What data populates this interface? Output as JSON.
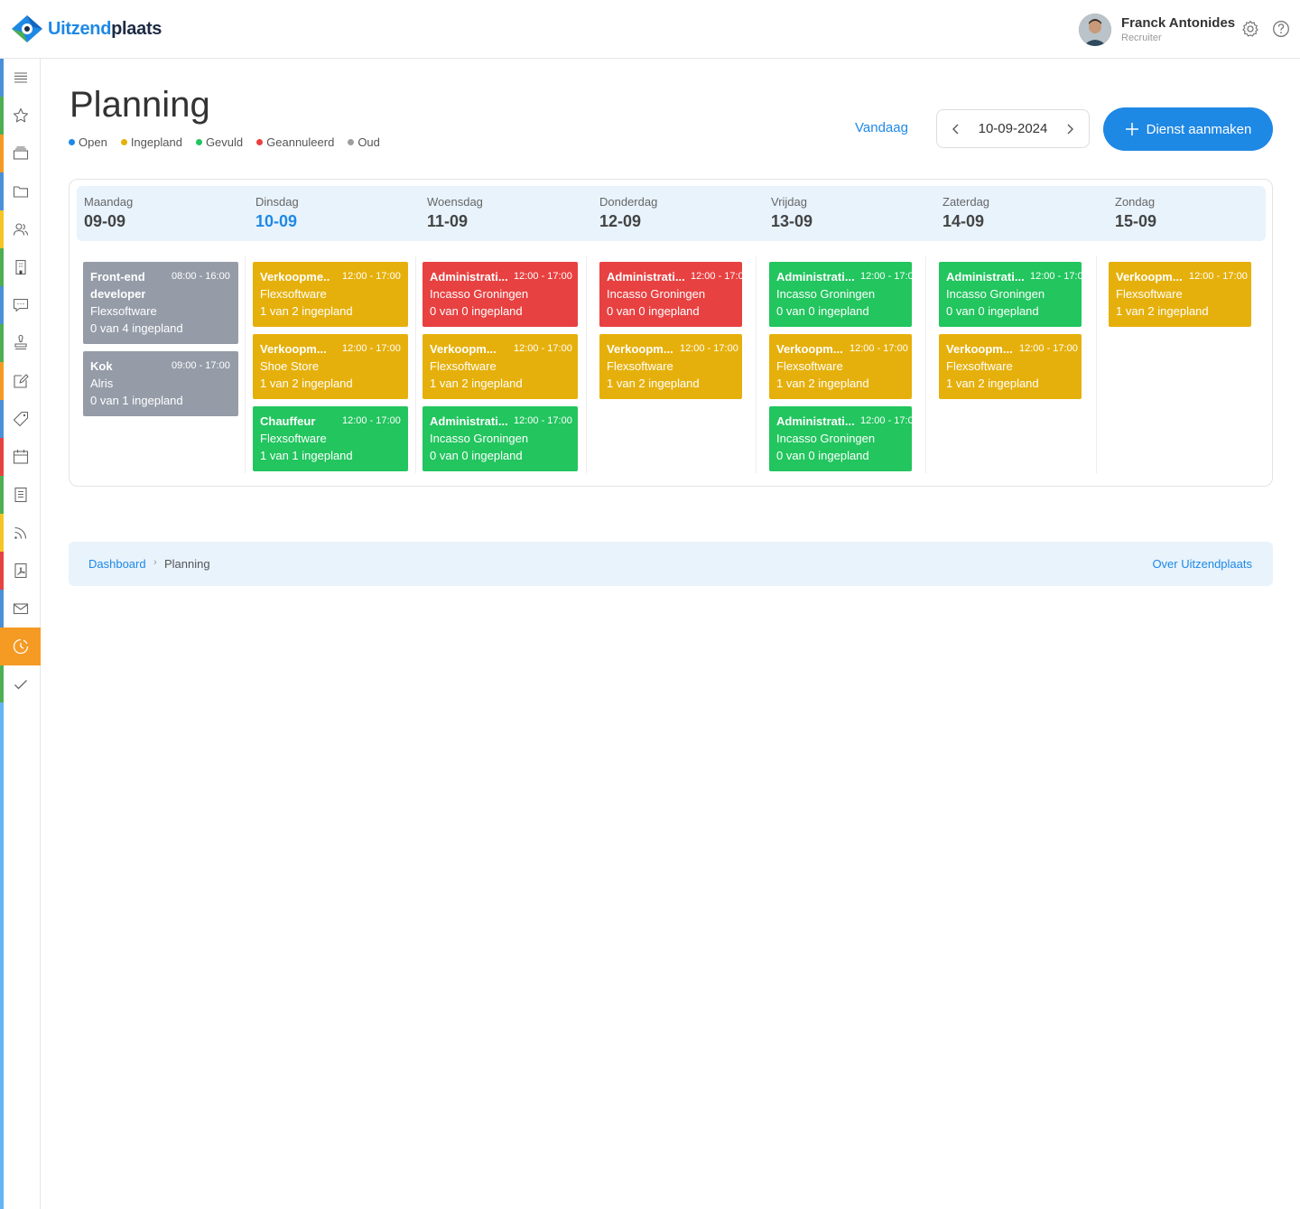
{
  "brand": {
    "name_part1": "Uitzend",
    "name_part2": "plaats"
  },
  "user": {
    "name": "Franck Antonides",
    "role": "Recruiter"
  },
  "page": {
    "title": "Planning"
  },
  "legend": [
    {
      "label": "Open",
      "color": "#1e88e5"
    },
    {
      "label": "Ingepland",
      "color": "#e6b00c"
    },
    {
      "label": "Gevuld",
      "color": "#22c55e"
    },
    {
      "label": "Geannuleerd",
      "color": "#e84141"
    },
    {
      "label": "Oud",
      "color": "#9e9e9e"
    }
  ],
  "toolbar": {
    "today_label": "Vandaag",
    "current_date": "10-09-2024",
    "create_label": "Dienst aanmaken"
  },
  "days": [
    {
      "name": "Maandag",
      "date": "09-09"
    },
    {
      "name": "Dinsdag",
      "date": "10-09"
    },
    {
      "name": "Woensdag",
      "date": "11-09"
    },
    {
      "name": "Donderdag",
      "date": "12-09"
    },
    {
      "name": "Vrijdag",
      "date": "13-09"
    },
    {
      "name": "Zaterdag",
      "date": "14-09"
    },
    {
      "name": "Zondag",
      "date": "15-09"
    }
  ],
  "shifts": {
    "mon": [
      {
        "title_1": "Front-end",
        "title_2": "developer",
        "time": "08:00 - 16:00",
        "company": "Flexsoftware",
        "status": "0 van 4 ingepland"
      },
      {
        "title": "Kok",
        "time": "09:00 - 17:00",
        "company": "Alris",
        "status": "0 van 1 ingepland"
      }
    ],
    "tue": [
      {
        "title": "Verkoopme..",
        "time": "12:00 - 17:00",
        "company": "Flexsoftware",
        "status": "1 van 2 ingepland"
      },
      {
        "title": "Verkoopm...",
        "time": "12:00 - 17:00",
        "company": "Shoe Store",
        "status": "1 van 2 ingepland"
      },
      {
        "title": "Chauffeur",
        "time": "12:00 - 17:00",
        "company": "Flexsoftware",
        "status": "1 van 1 ingepland"
      }
    ],
    "wed": [
      {
        "title": "Administrati...",
        "time": "12:00 - 17:00",
        "company": "Incasso Groningen",
        "status": "0 van 0 ingepland"
      },
      {
        "title": "Verkoopm...",
        "time": "12:00 - 17:00",
        "company": "Flexsoftware",
        "status": "1 van 2 ingepland"
      },
      {
        "title": "Administrati...",
        "time": "12:00 - 17:00",
        "company": "Incasso Groningen",
        "status": "0 van 0 ingepland"
      }
    ],
    "thu": [
      {
        "title": "Administrati...",
        "time": "12:00 - 17:0",
        "company": "Incasso Groningen",
        "status": "0 van 0 ingepland"
      },
      {
        "title": "Verkoopm...",
        "time": "12:00 - 17:00",
        "company": "Flexsoftware",
        "status": "1 van 2 ingepland"
      }
    ],
    "fri": [
      {
        "title": "Administrati...",
        "time": "12:00 - 17:0",
        "company": "Incasso Groningen",
        "status": "0 van 0 ingepland"
      },
      {
        "title": "Verkoopm...",
        "time": "12:00 - 17:00",
        "company": "Flexsoftware",
        "status": "1 van 2 ingepland"
      },
      {
        "title": "Administrati...",
        "time": "12:00 - 17:0",
        "company": "Incasso Groningen",
        "status": "0 van 0 ingepland"
      }
    ],
    "sat": [
      {
        "title": "Administrati...",
        "time": "12:00 - 17:0",
        "company": "Incasso Groningen",
        "status": "0 van 0 ingepland"
      },
      {
        "title": "Verkoopm...",
        "time": "12:00 - 17:00",
        "company": "Flexsoftware",
        "status": "1 van 2 ingepland"
      }
    ],
    "sun": [
      {
        "title": "Verkoopm...",
        "time": "12:00 - 17:00",
        "company": "Flexsoftware",
        "status": "1 van 2 ingepland"
      }
    ]
  },
  "breadcrumb": {
    "root": "Dashboard",
    "separator": "›",
    "current": "Planning",
    "about": "Over Uitzendplaats"
  },
  "sidebar_icons": [
    "menu-icon",
    "star-icon",
    "layers-icon",
    "folder-icon",
    "users-icon",
    "building-icon",
    "chat-icon",
    "stamp-icon",
    "edit-icon",
    "tag-icon",
    "calendar-icon",
    "document-icon",
    "rss-icon",
    "pdf-icon",
    "mail-icon",
    "clock-icon",
    "check-icon"
  ]
}
